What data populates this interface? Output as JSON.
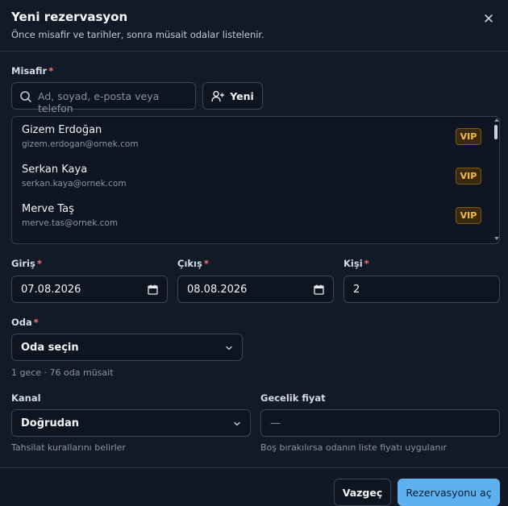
{
  "header": {
    "title": "Yeni rezervasyon",
    "subtitle": "Önce misafir ve tarihler, sonra müsait odalar listelenir.",
    "close_glyph": "✕"
  },
  "guest": {
    "label": "Misafir",
    "required": "*",
    "search_placeholder": "Ad, soyad, e-posta veya telefon",
    "new_button": "Yeni",
    "list": [
      {
        "name": "Gizem Erdoğan",
        "email": "gizem.erdogan@ornek.com",
        "badge": "VIP"
      },
      {
        "name": "Serkan Kaya",
        "email": "serkan.kaya@ornek.com",
        "badge": "VIP"
      },
      {
        "name": "Merve Taş",
        "email": "merve.tas@ornek.com",
        "badge": "VIP"
      }
    ]
  },
  "dates": {
    "checkin_label": "Giriş",
    "checkin_value": "07.08.2026",
    "checkout_label": "Çıkış",
    "checkout_value": "08.08.2026",
    "persons_label": "Kişi",
    "persons_value": "2",
    "required": "*"
  },
  "room": {
    "label": "Oda",
    "required": "*",
    "selected": "Oda seçin",
    "hint": "1 gece · 76 oda müsait"
  },
  "channel": {
    "label": "Kanal",
    "selected": "Doğrudan",
    "hint": "Tahsilat kurallarını belirler"
  },
  "price": {
    "label": "Gecelik fiyat",
    "placeholder": "—",
    "hint": "Boş bırakılırsa odanın liste fiyatı uygulanır"
  },
  "footer": {
    "cancel": "Vazgeç",
    "submit": "Rezervasyonu aç"
  },
  "colors": {
    "background": "#131a27",
    "primary": "#5fb0ee",
    "vip_text": "#f5b94a",
    "required": "#f87171"
  },
  "icons": {
    "close": "close-icon",
    "search": "search-icon",
    "add_user": "user-plus-icon",
    "calendar": "calendar-icon",
    "dropdown": "chevron-down-icon"
  }
}
